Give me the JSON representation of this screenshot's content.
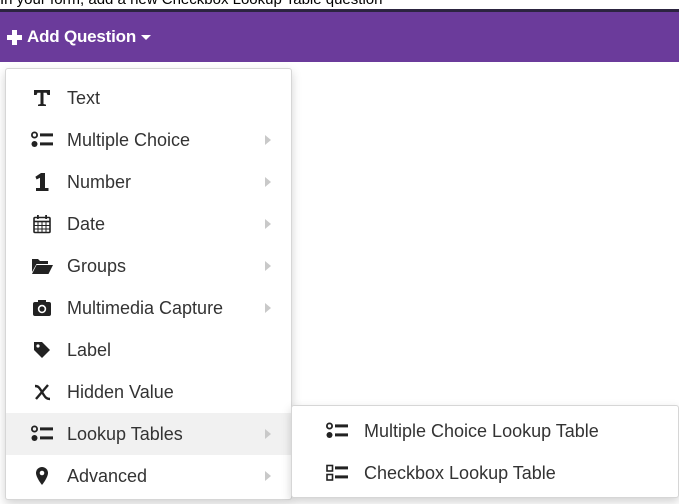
{
  "instruction": "In your form, add a new Checkbox Lookup Table question",
  "toolbar": {
    "add_question_label": "Add Question"
  },
  "colors": {
    "toolbar_bg": "#6b3b9b",
    "active_item_bg": "#f1f1f1"
  },
  "menu": {
    "items": [
      {
        "label": "Text",
        "icon": "text-t-icon",
        "has_submenu": false
      },
      {
        "label": "Multiple Choice",
        "icon": "list-choice-icon",
        "has_submenu": true
      },
      {
        "label": "Number",
        "icon": "number-one-icon",
        "has_submenu": true
      },
      {
        "label": "Date",
        "icon": "calendar-icon",
        "has_submenu": true
      },
      {
        "label": "Groups",
        "icon": "folder-open-icon",
        "has_submenu": true
      },
      {
        "label": "Multimedia Capture",
        "icon": "camera-icon",
        "has_submenu": true
      },
      {
        "label": "Label",
        "icon": "tag-icon",
        "has_submenu": false
      },
      {
        "label": "Hidden Value",
        "icon": "variable-x-icon",
        "has_submenu": false
      },
      {
        "label": "Lookup Tables",
        "icon": "list-choice-icon",
        "has_submenu": true,
        "active": true
      },
      {
        "label": "Advanced",
        "icon": "map-marker-icon",
        "has_submenu": true
      }
    ]
  },
  "submenu": {
    "items": [
      {
        "label": "Multiple Choice Lookup Table",
        "icon": "list-choice-icon"
      },
      {
        "label": "Checkbox Lookup Table",
        "icon": "checkbox-list-icon"
      }
    ]
  }
}
